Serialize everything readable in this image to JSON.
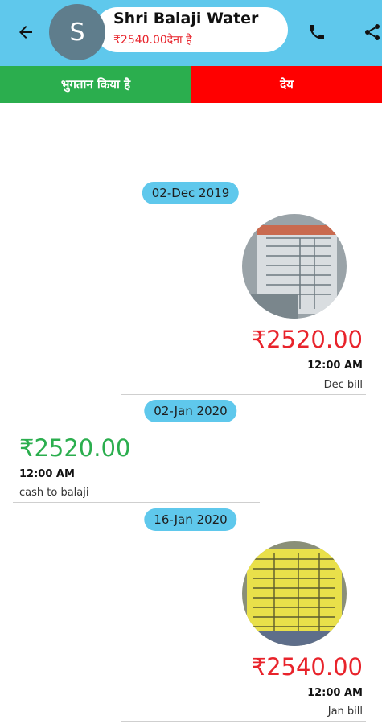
{
  "header": {
    "avatar_letter": "S",
    "name": "Shri Balaji Water",
    "due_text": "₹2540.00देना है",
    "bar_color": "#5fc8ec"
  },
  "tabs": {
    "paid_label": "भुगतान किया है",
    "due_label": "देय"
  },
  "transactions": [
    {
      "date": "02-Dec 2019",
      "amount": "₹2520.00",
      "time": "12:00 AM",
      "note": "Dec bill",
      "type": "due",
      "photo": "bill-photo"
    },
    {
      "date": "02-Jan 2020",
      "amount": "₹2520.00",
      "time": "12:00 AM",
      "note": "cash to balaji",
      "type": "paid"
    },
    {
      "date": "16-Jan 2020",
      "amount": "₹2540.00",
      "time": "12:00 AM",
      "note": "Jan bill",
      "type": "due",
      "photo": "bill-photo"
    }
  ],
  "colors": {
    "paid": "#2bae4e",
    "due": "#ff0000",
    "amount_red": "#e8232b"
  }
}
